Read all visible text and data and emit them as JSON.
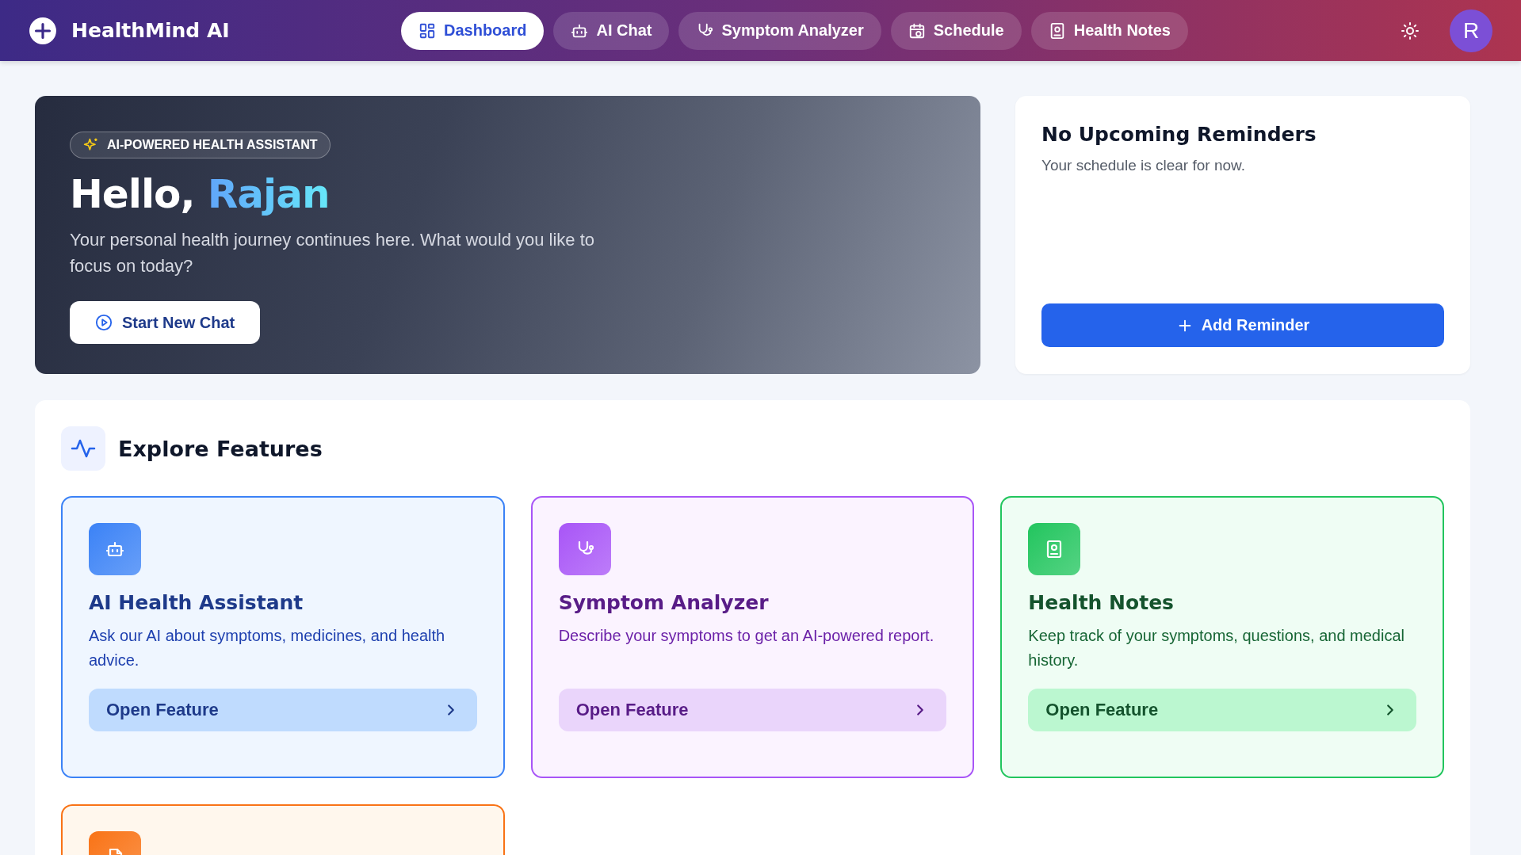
{
  "header": {
    "brand": "HealthMind AI",
    "nav": [
      {
        "label": "Dashboard",
        "kind": "grid",
        "selected": true
      },
      {
        "label": "AI Chat",
        "kind": "bot",
        "selected": false
      },
      {
        "label": "Symptom Analyzer",
        "kind": "stethoscope",
        "selected": false
      },
      {
        "label": "Schedule",
        "kind": "calendar",
        "selected": false
      },
      {
        "label": "Health Notes",
        "kind": "notes",
        "selected": false
      }
    ],
    "avatar": "R"
  },
  "hero": {
    "badge": "AI-POWERED HEALTH ASSISTANT",
    "greeting": "Hello,",
    "name": "Rajan",
    "subtitle": "Your personal health journey continues here. What would you like to focus on today?",
    "button": "Start New Chat"
  },
  "reminders": {
    "title": "No Upcoming Reminders",
    "subtitle": "Your schedule is clear for now.",
    "button": "Add Reminder"
  },
  "features": {
    "title": "Explore Features",
    "cards": [
      {
        "kind": "bot",
        "color": "#3b82f6",
        "title": "AI Health Assistant",
        "description": "Ask our AI about symptoms, medicines, and health advice.",
        "button": "Open Feature"
      },
      {
        "kind": "stethoscope",
        "color": "#a855f7",
        "title": "Symptom Analyzer",
        "description": "Describe your symptoms to get an AI-powered report.",
        "button": "Open Feature"
      },
      {
        "kind": "notes",
        "color": "#22c55e",
        "title": "Health Notes",
        "description": "Keep track of your symptoms, questions, and medical history.",
        "button": "Open Feature"
      },
      {
        "kind": "file",
        "color": "#f97316"
      }
    ]
  }
}
